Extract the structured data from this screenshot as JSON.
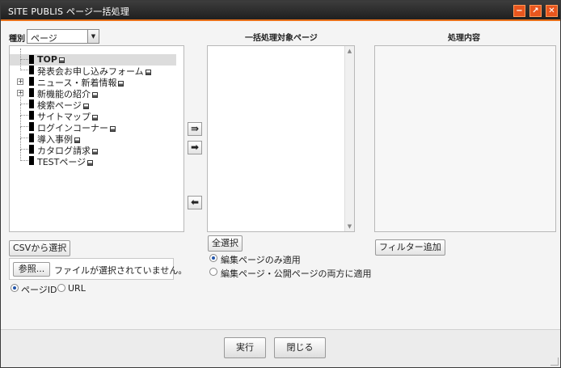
{
  "window": {
    "title": "SITE PUBLIS ページ一括処理",
    "minimize": "−",
    "maximize": "↗",
    "close": "✕"
  },
  "left": {
    "kind_label": "種別",
    "kind_value": "ページ",
    "tree": [
      {
        "label": "TOP",
        "selected": true,
        "expander": false
      },
      {
        "label": "発表会お申し込みフォーム",
        "expander": false
      },
      {
        "label": "ニュース・新着情報",
        "expander": true
      },
      {
        "label": "新機能の紹介",
        "expander": true
      },
      {
        "label": "検索ページ",
        "expander": false
      },
      {
        "label": "サイトマップ",
        "expander": false
      },
      {
        "label": "ログインコーナー",
        "expander": false
      },
      {
        "label": "導入事例",
        "expander": false
      },
      {
        "label": "カタログ請求",
        "expander": false
      },
      {
        "label": "TESTページ",
        "expander": false
      }
    ],
    "csv_button": "CSVから選択",
    "browse_button": "参照...",
    "file_status": "ファイルが選択されていません。",
    "radio_pageid": "ページID",
    "radio_url": "URL"
  },
  "middle": {
    "header": "一括処理対象ページ",
    "select_all": "全選択",
    "radio_edit_only": "編集ページのみ適用",
    "radio_both": "編集ページ・公開ページの両方に適用"
  },
  "right": {
    "header": "処理内容",
    "add_filter": "フィルター追加"
  },
  "footer": {
    "run": "実行",
    "close": "閉じる"
  },
  "colors": {
    "accent": "#e8701a",
    "titlebar": "#2b2b2b"
  }
}
